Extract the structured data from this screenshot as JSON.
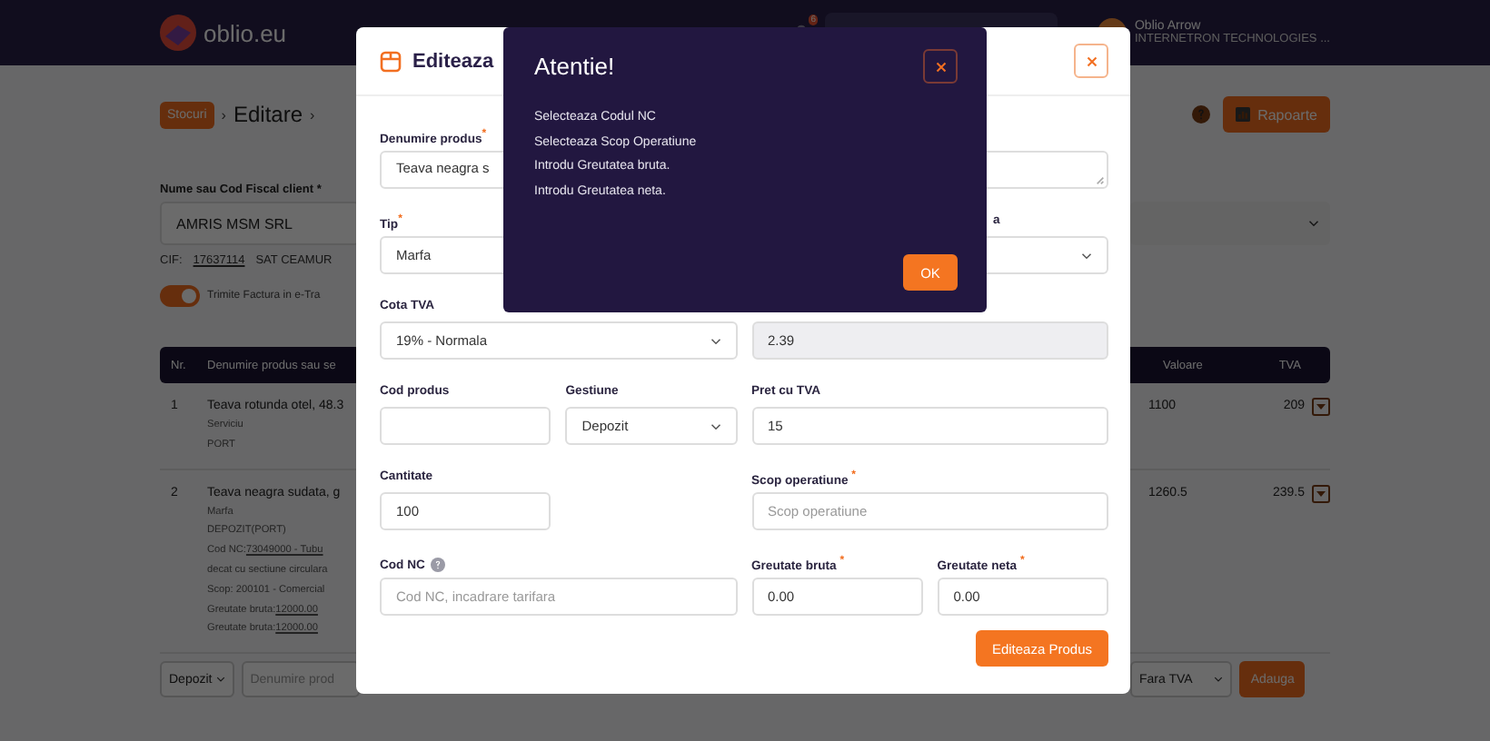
{
  "header": {
    "logo": "oblio.eu",
    "notifications": "6",
    "user": {
      "name": "Oblio Arrow",
      "company": "INTERNETRON TECHNOLOGIES ..."
    }
  },
  "page": {
    "breadcrumb": [
      {
        "text": "Stocuri",
        "kind": "badge",
        "sep": "›"
      },
      {
        "text": "Editare",
        "kind": "title",
        "sep": "›"
      }
    ],
    "report_button": "Rapoarte",
    "client_label": "Nume sau Cod Fiscal client *",
    "client": "AMRIS MSM SRL",
    "cif_label": "CIF:",
    "cif": "17637114",
    "address": "SAT CEAMUR",
    "einvoice": {
      "label": "Trimite Factura in e-Tra",
      "on": true
    },
    "table": {
      "columns": [
        "Nr.",
        "Denumire produs sau se",
        "Valoare",
        "TVA"
      ],
      "rows": [
        {
          "nr": "1",
          "name": "Teava rotunda otel, 48.3",
          "lines": [
            {
              "text": "Serviciu"
            },
            {
              "text": "PORT"
            }
          ],
          "value": "1100",
          "vat": "209"
        },
        {
          "nr": "2",
          "name": "Teava neagra sudata, g",
          "lines": [
            {
              "text": "Marfa"
            },
            {
              "text": "DEPOZIT(PORT)"
            },
            {
              "text": "Cod NC:",
              "value": "73049000 - Tubu"
            },
            {
              "text": "decat cu sectiune circulara"
            },
            {
              "text": "Scop: 200101 - Comercial"
            },
            {
              "text": "Greutate bruta:",
              "value": "12000.00"
            },
            {
              "text": "Greutate bruta:",
              "value": "12000.00"
            }
          ],
          "value": "1260.5",
          "vat": "239.5"
        }
      ]
    },
    "add_row": {
      "warehouse": "Depozit",
      "product_placeholder": "Denumire prod",
      "vat": "Fara TVA",
      "button": "Adauga"
    }
  },
  "modal": {
    "title": "Editeaza",
    "name": {
      "label": "Denumire produs",
      "mark": "*",
      "value": "Teava neagra s"
    },
    "type": {
      "label": "Tip",
      "mark": "*",
      "value": "Marfa"
    },
    "unit": {
      "label": "a"
    },
    "vat_rate": {
      "label": "Cota TVA",
      "value": "19% - Normala"
    },
    "price_net": {
      "value": "2.39"
    },
    "code": {
      "label": "Cod produs"
    },
    "warehouse": {
      "label": "Gestiune",
      "value": "Depozit"
    },
    "price": {
      "label": "Pret cu TVA",
      "value": "15"
    },
    "quantity": {
      "label": "Cantitate",
      "value": "100"
    },
    "purpose": {
      "label": "Scop operatiune",
      "mark": "*",
      "placeholder": "Scop operatiune"
    },
    "nc": {
      "label": "Cod NC",
      "placeholder": "Cod NC, incadrare tarifara"
    },
    "gross": {
      "label": "Greutate bruta",
      "mark": "*",
      "value": "0.00"
    },
    "net": {
      "label": "Greutate neta",
      "mark": "*",
      "value": "0.00"
    },
    "submit": "Editeaza Produs"
  },
  "alert": {
    "title": "Atentie!",
    "messages": [
      "Selecteaza Codul NC",
      "Selecteaza Scop Operatiune",
      "Introdu Greutatea bruta.",
      "Introdu Greutatea neta."
    ],
    "button": "OK"
  }
}
